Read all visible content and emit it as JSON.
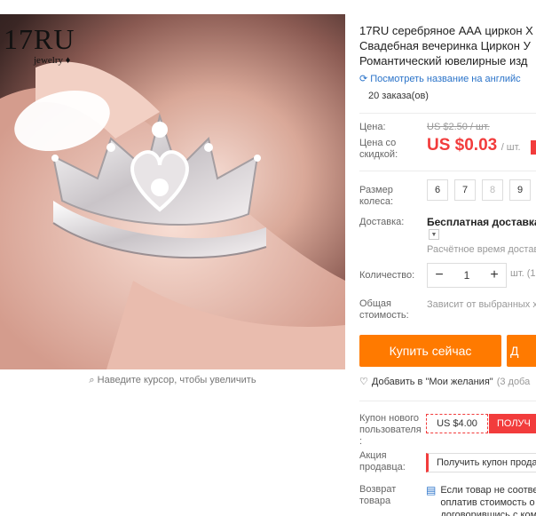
{
  "brand": {
    "main": "17RU",
    "sub": "jewelry"
  },
  "zoom_hint": "Наведите курсор, чтобы увеличить",
  "product": {
    "title_lines": [
      "17RU серебряное ААА циркон Х",
      "Свадебная вечеринка Циркон У",
      "Романтический ювелирные изд"
    ],
    "translate_label": "Посмотреть название на английс",
    "orders": "20 заказа(ов)"
  },
  "price": {
    "label": "Цена:",
    "original": "US $2.50 / шт.",
    "discount_label": "Цена со скидкой:",
    "current": "US $0.03",
    "unit": "/ шт."
  },
  "size": {
    "label": "Размер колеса:",
    "options": [
      {
        "value": "6",
        "disabled": false
      },
      {
        "value": "7",
        "disabled": false
      },
      {
        "value": "8",
        "disabled": true
      },
      {
        "value": "9",
        "disabled": false
      }
    ]
  },
  "shipping": {
    "label": "Доставка:",
    "value": "Бесплатная доставка в",
    "estimate": "Расчётное время доставки"
  },
  "quantity": {
    "label": "Количество:",
    "value": "1",
    "note": "шт. (1"
  },
  "total": {
    "label": "Общая стоимость:",
    "value": "Зависит от выбранных хар"
  },
  "actions": {
    "buy": "Купить сейчас",
    "cart": "Д",
    "wishlist": "Добавить в \"Мои желания\"",
    "wishlist_count": "(3 доба"
  },
  "coupon": {
    "label": "Купон нового пользователя :",
    "amount": "US $4.00",
    "get": "ПОЛУЧ"
  },
  "promo": {
    "label": "Акция продавца:",
    "value": "Получить купон прода"
  },
  "returns": {
    "label": "Возврат товара",
    "lines": [
      "Если товар не соотве",
      "оплатив стоимость о",
      "договорившись с ком"
    ]
  },
  "colors": {
    "accent": "#ff7a00",
    "price": "#f23c3c",
    "link": "#2a73c9"
  }
}
